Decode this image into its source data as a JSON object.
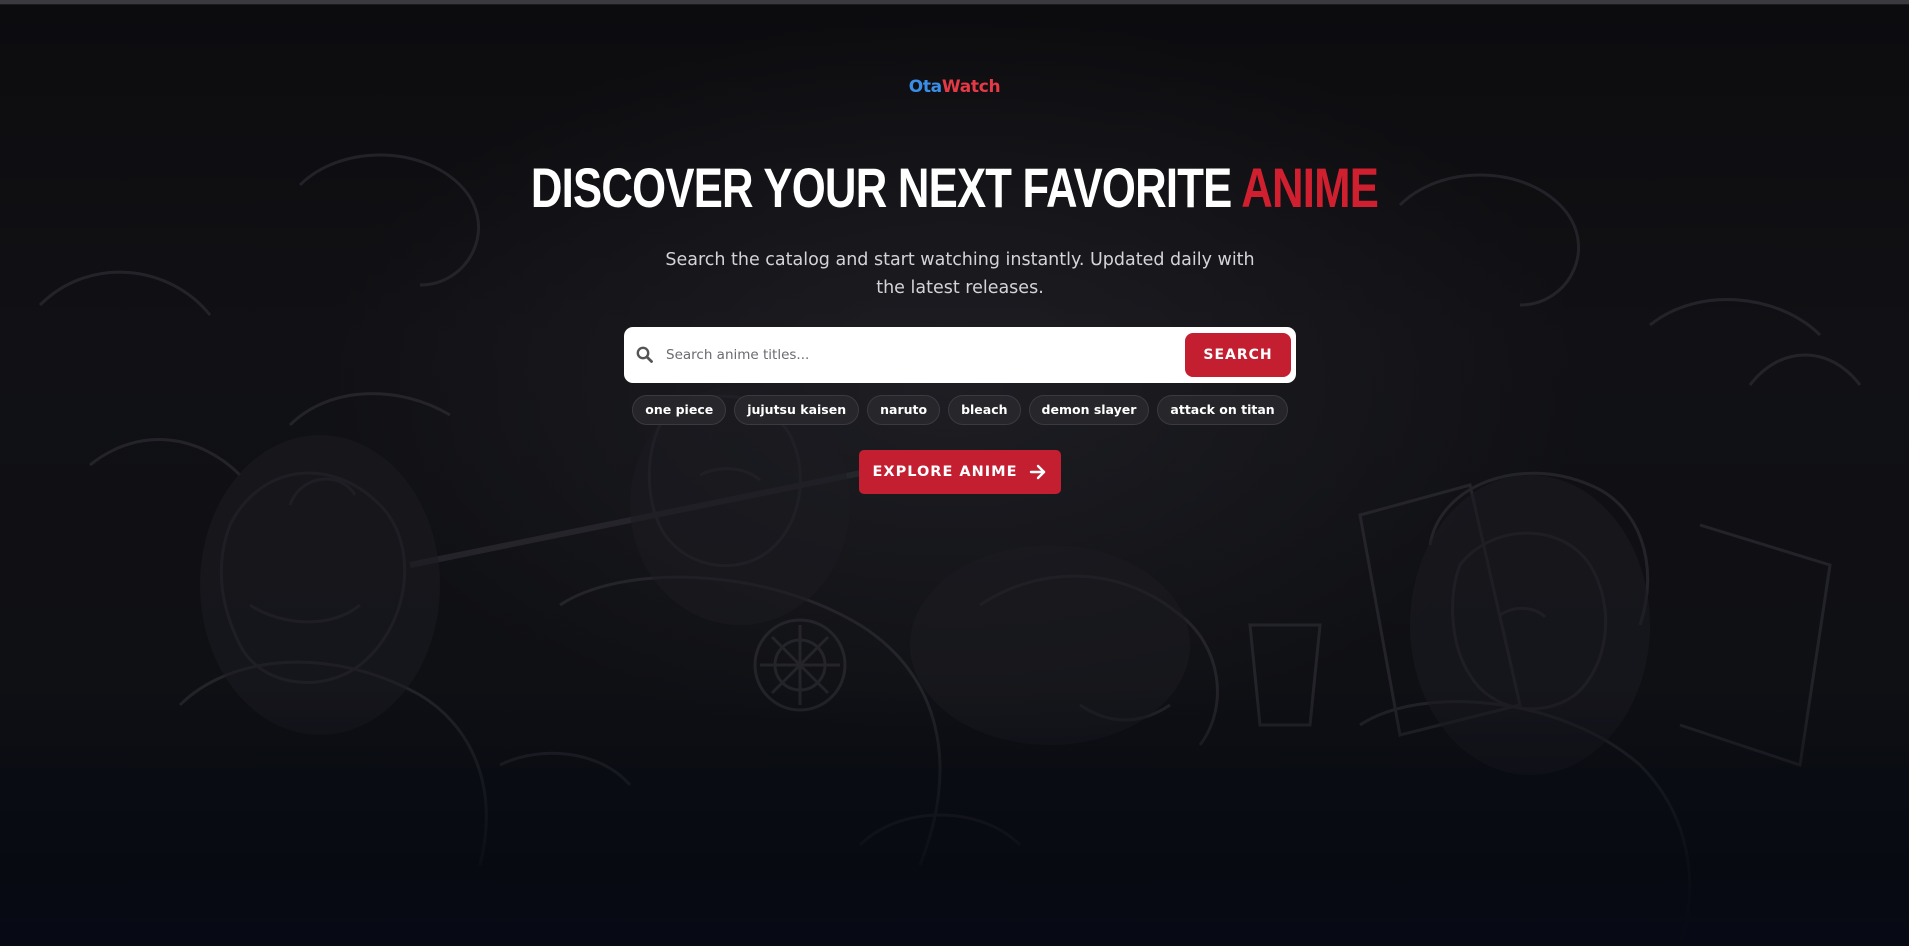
{
  "brand": {
    "part1": "Ota",
    "part2": "Watch"
  },
  "hero": {
    "headline_main": "DISCOVER YOUR NEXT FAVORITE ",
    "headline_accent": "ANIME",
    "subtitle": "Search the catalog and start watching instantly. Updated daily with the latest releases."
  },
  "search": {
    "placeholder": "Search anime titles...",
    "value": "",
    "button_label": "SEARCH",
    "icon": "search-icon"
  },
  "tags": [
    {
      "label": "one piece"
    },
    {
      "label": "jujutsu kaisen"
    },
    {
      "label": "naruto"
    },
    {
      "label": "bleach"
    },
    {
      "label": "demon slayer"
    },
    {
      "label": "attack on titan"
    }
  ],
  "cta": {
    "label": "EXPLORE ANIME",
    "icon": "arrow-right-icon"
  },
  "colors": {
    "accent_red": "#c41f31",
    "brand_blue": "#3b8ee8",
    "brand_red": "#e53945",
    "background": "#0b0c10"
  }
}
